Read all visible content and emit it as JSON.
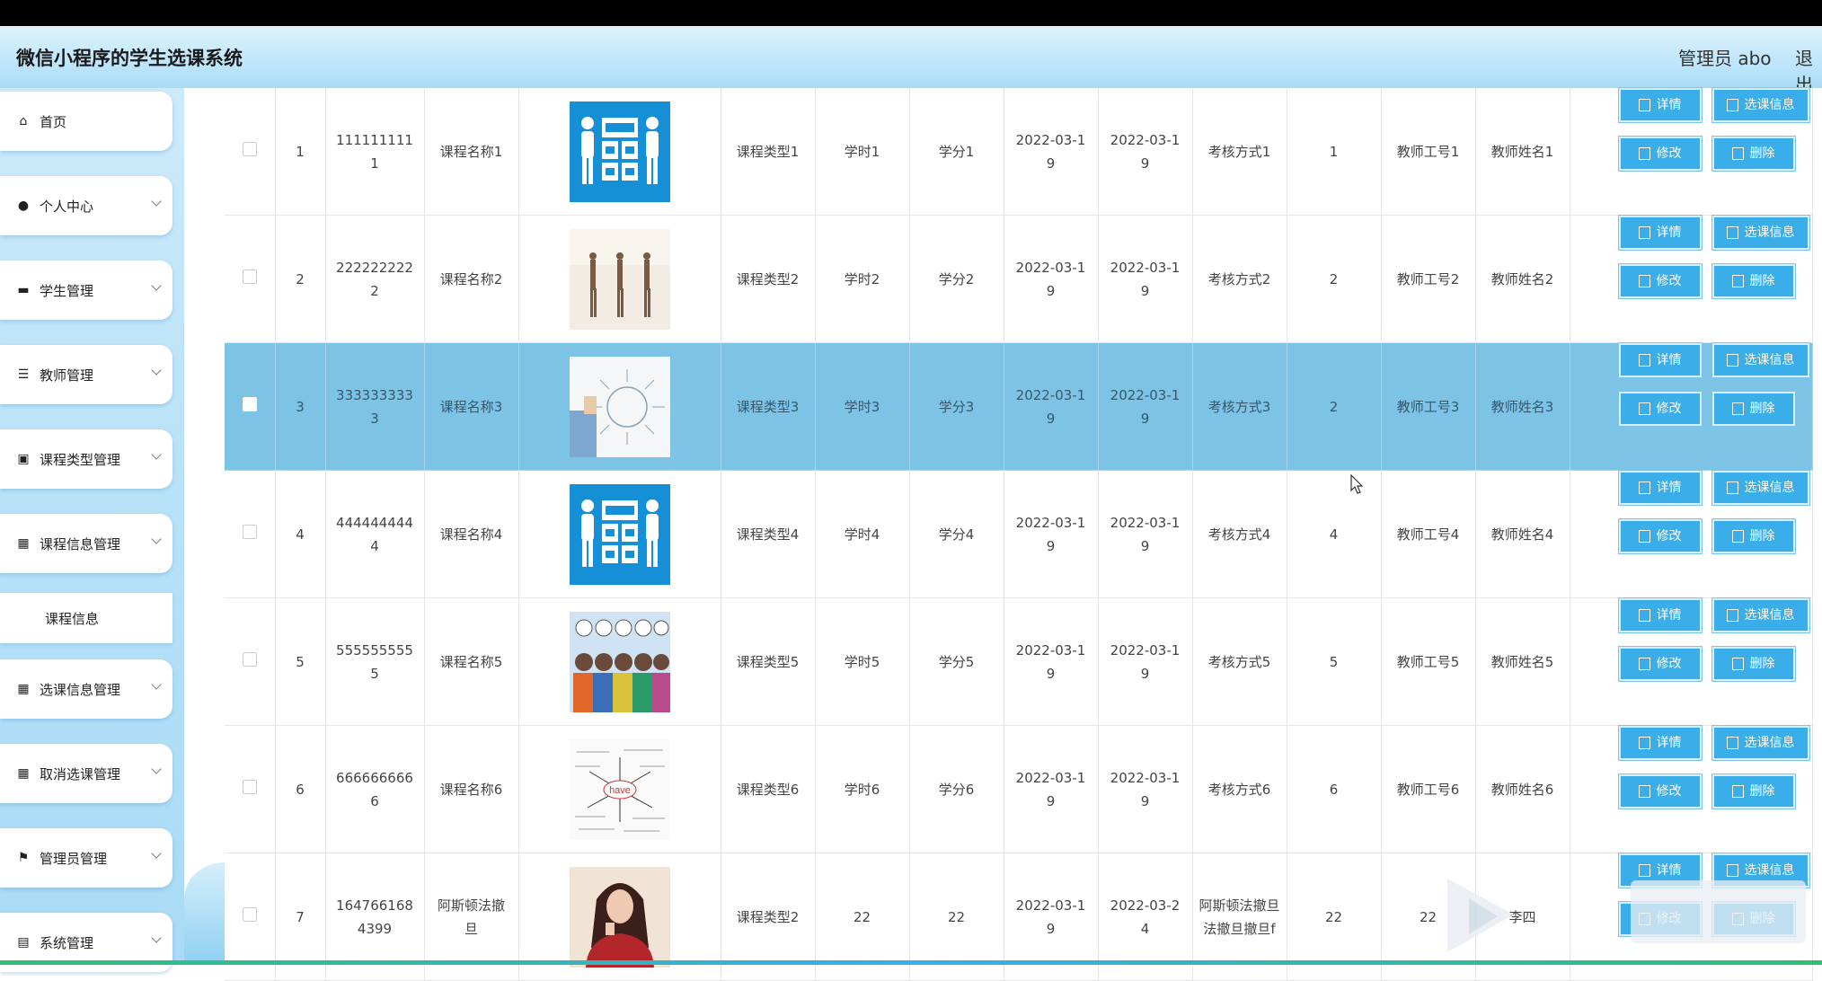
{
  "header": {
    "title": "微信小程序的学生选课系统",
    "user": "管理员 abo",
    "logout": "退出"
  },
  "sidebar": {
    "items": [
      {
        "label": "首页",
        "icon": "home-icon"
      },
      {
        "label": "个人中心",
        "icon": "user-icon"
      },
      {
        "label": "学生管理",
        "icon": "briefcase-icon"
      },
      {
        "label": "教师管理",
        "icon": "sliders-icon"
      },
      {
        "label": "课程类型管理",
        "icon": "clipboard-icon"
      },
      {
        "label": "课程信息管理",
        "icon": "grid-icon"
      },
      {
        "label": "选课信息管理",
        "icon": "grid-icon"
      },
      {
        "label": "取消选课管理",
        "icon": "grid-icon"
      },
      {
        "label": "管理员管理",
        "icon": "flag-icon"
      },
      {
        "label": "系统管理",
        "icon": "book-icon"
      }
    ],
    "subitem": "课程信息"
  },
  "buttons": {
    "detail": "详情",
    "selection_info": "选课信息",
    "edit": "修改",
    "delete": "删除"
  },
  "rows": [
    {
      "index": "1",
      "code_a": "111111111",
      "code_b": "1",
      "name_a": "课程名称1",
      "name_b": "",
      "type": "课程类型1",
      "hours": "学时1",
      "credit": "学分1",
      "start_a": "2022-03-1",
      "start_b": "9",
      "end_a": "2022-03-1",
      "end_b": "9",
      "exam": "考核方式1",
      "count": "1",
      "teacher_id": "教师工号1",
      "teacher_name": "教师姓名1",
      "image": "english-corner"
    },
    {
      "index": "2",
      "code_a": "222222222",
      "code_b": "2",
      "name_a": "课程名称2",
      "name_b": "",
      "type": "课程类型2",
      "hours": "学时2",
      "credit": "学分2",
      "start_a": "2022-03-1",
      "start_b": "9",
      "end_a": "2022-03-1",
      "end_b": "9",
      "exam": "考核方式2",
      "count": "2",
      "teacher_id": "教师工号2",
      "teacher_name": "教师姓名2",
      "image": "dancers"
    },
    {
      "index": "3",
      "code_a": "333333333",
      "code_b": "3",
      "name_a": "课程名称3",
      "name_b": "",
      "type": "课程类型3",
      "hours": "学时3",
      "credit": "学分3",
      "start_a": "2022-03-1",
      "start_b": "9",
      "end_a": "2022-03-1",
      "end_b": "9",
      "exam": "考核方式3",
      "count": "2",
      "teacher_id": "教师工号3",
      "teacher_name": "教师姓名3",
      "image": "business-training"
    },
    {
      "index": "4",
      "code_a": "444444444",
      "code_b": "4",
      "name_a": "课程名称4",
      "name_b": "",
      "type": "课程类型4",
      "hours": "学时4",
      "credit": "学分4",
      "start_a": "2022-03-1",
      "start_b": "9",
      "end_a": "2022-03-1",
      "end_b": "9",
      "exam": "考核方式4",
      "count": "4",
      "teacher_id": "教师工号4",
      "teacher_name": "教师姓名4",
      "image": "english-corner"
    },
    {
      "index": "5",
      "code_a": "555555555",
      "code_b": "5",
      "name_a": "课程名称5",
      "name_b": "",
      "type": "课程类型5",
      "hours": "学时5",
      "credit": "学分5",
      "start_a": "2022-03-1",
      "start_b": "9",
      "end_a": "2022-03-1",
      "end_b": "9",
      "exam": "考核方式5",
      "count": "5",
      "teacher_id": "教师工号5",
      "teacher_name": "教师姓名5",
      "image": "hello-kids"
    },
    {
      "index": "6",
      "code_a": "666666666",
      "code_b": "6",
      "name_a": "课程名称6",
      "name_b": "",
      "type": "课程类型6",
      "hours": "学时6",
      "credit": "学分6",
      "start_a": "2022-03-1",
      "start_b": "9",
      "end_a": "2022-03-1",
      "end_b": "9",
      "exam": "考核方式6",
      "count": "6",
      "teacher_id": "教师工号6",
      "teacher_name": "教师姓名6",
      "image": "have-words"
    },
    {
      "index": "7",
      "code_a": "164766168",
      "code_b": "4399",
      "name_a": "阿斯顿法撤",
      "name_b": "旦",
      "type": "课程类型2",
      "hours": "22",
      "credit": "22",
      "start_a": "2022-03-1",
      "start_b": "9",
      "end_a": "2022-03-2",
      "end_b": "4",
      "exam": "阿斯顿法撤旦法撤旦撤旦f",
      "count": "22",
      "teacher_id": "22",
      "teacher_name": "李四",
      "image": "portrait"
    }
  ],
  "selected_row": 3,
  "colors": {
    "header_bg": "#bfe6fb",
    "sidebar_bg": "#b6e1f8",
    "selected_row_bg": "#7dc3e6",
    "button_bg": "#3aaee8"
  }
}
